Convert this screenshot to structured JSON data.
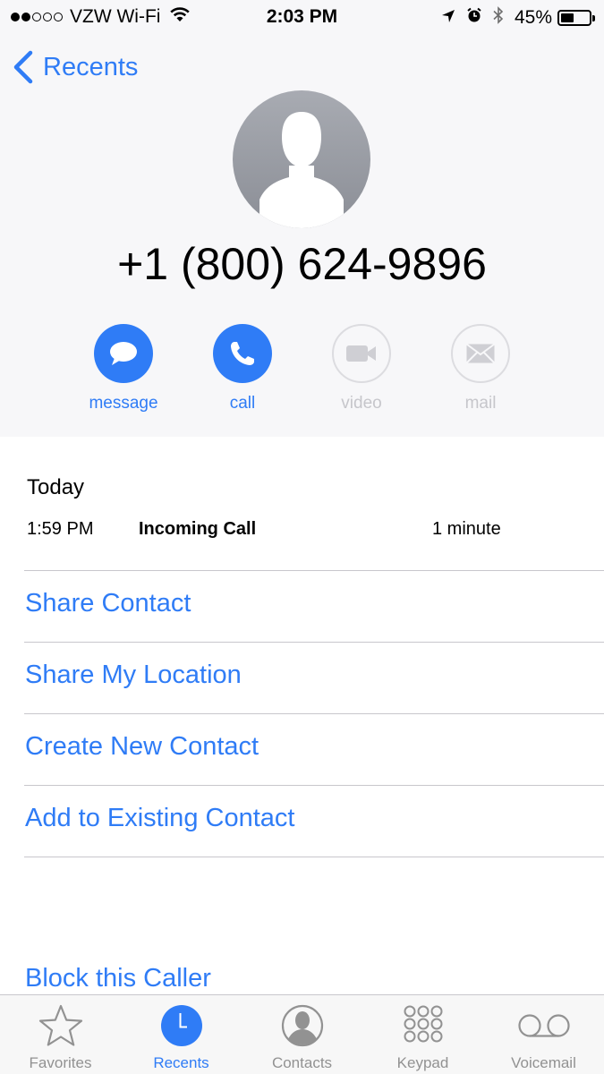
{
  "status_bar": {
    "carrier": "VZW Wi-Fi",
    "time": "2:03 PM",
    "battery": "45%",
    "battery_level": 0.45,
    "signal_bars": 2,
    "icons": [
      "signal-dots-icon",
      "wifi-icon",
      "location-arrow-icon",
      "alarm-icon",
      "bluetooth-icon",
      "battery-icon"
    ]
  },
  "nav": {
    "back_label": "Recents",
    "back_icon": "chevron-left-icon"
  },
  "contact": {
    "avatar_icon": "person-silhouette-icon",
    "phone_number": "+1 (800) 624-9896"
  },
  "actions": [
    {
      "label": "message",
      "icon": "speech-bubble-icon",
      "enabled": true
    },
    {
      "label": "call",
      "icon": "phone-icon",
      "enabled": true
    },
    {
      "label": "video",
      "icon": "video-camera-icon",
      "enabled": false
    },
    {
      "label": "mail",
      "icon": "envelope-icon",
      "enabled": false
    }
  ],
  "recent_calls": {
    "section_title": "Today",
    "entries": [
      {
        "time": "1:59 PM",
        "type": "Incoming Call",
        "duration": "1 minute"
      }
    ]
  },
  "options": [
    "Share Contact",
    "Share My Location",
    "Create New Contact",
    "Add to Existing Contact"
  ],
  "block_label": "Block this Caller",
  "tab_bar": {
    "active": "Recents",
    "tabs": [
      {
        "label": "Favorites",
        "icon": "star-icon"
      },
      {
        "label": "Recents",
        "icon": "clock-icon"
      },
      {
        "label": "Contacts",
        "icon": "person-circle-icon"
      },
      {
        "label": "Keypad",
        "icon": "keypad-icon"
      },
      {
        "label": "Voicemail",
        "icon": "voicemail-icon"
      }
    ]
  },
  "colors": {
    "accent": "#2f7cf6",
    "header_background": "#f7f7f9",
    "disabled": "#c6c6cb",
    "separator": "#c8c7cc",
    "inactive_tab": "#929292"
  }
}
